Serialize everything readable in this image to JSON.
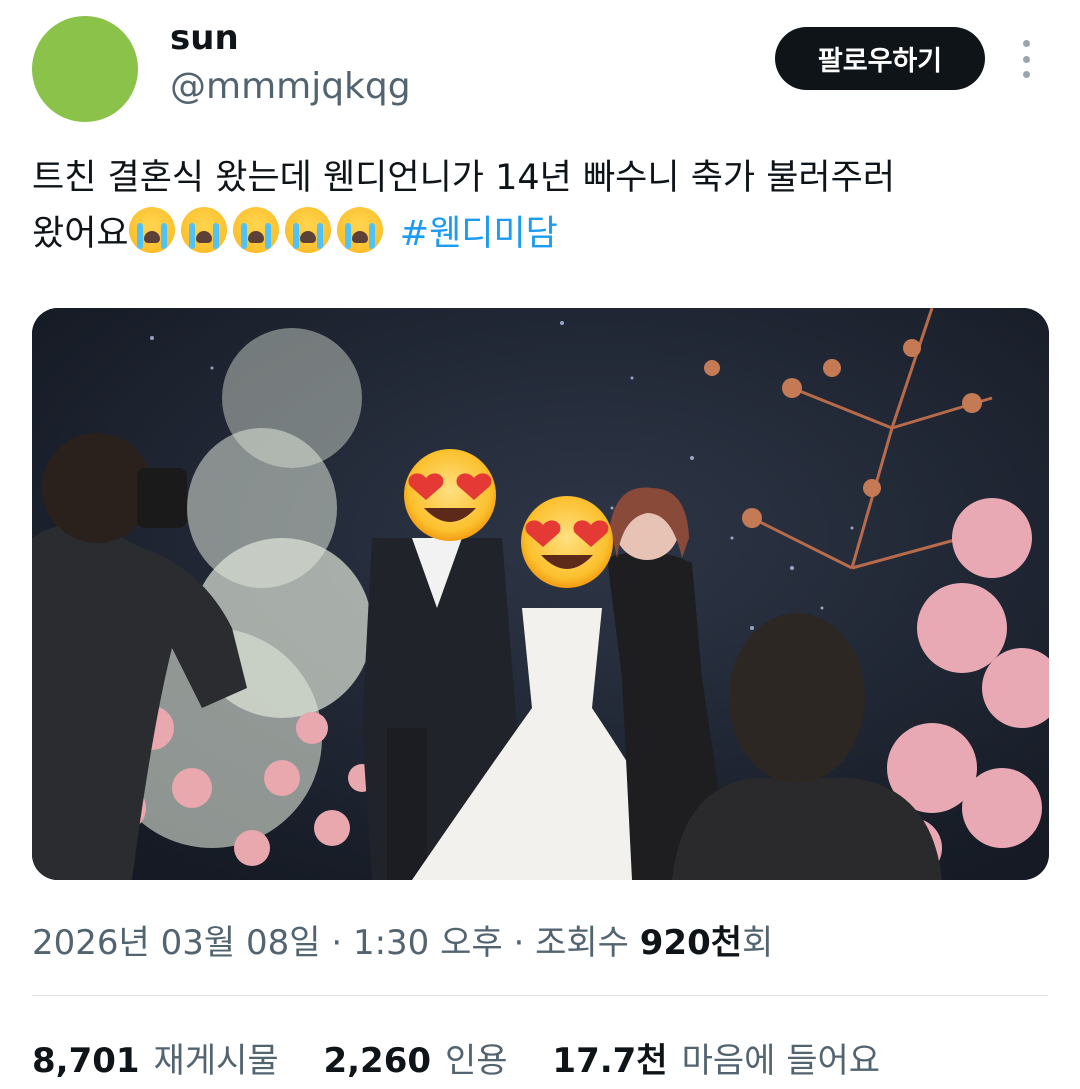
{
  "user": {
    "display_name": "sun",
    "handle": "@mmmjqkqg",
    "avatar_color": "#8bc34a"
  },
  "follow_button_label": "팔로우하기",
  "more_icon": "more-vertical-icon",
  "tweet": {
    "text_line1": "트친 결혼식 왔는데 웬디언니가 14년 빠수니 축가 불러주러",
    "text_line2_prefix": "왔어요",
    "emoji_name": "loudly-crying-face-emoji",
    "emoji_count": 5,
    "hashtag": "#웬디미담"
  },
  "meta": {
    "date": "2026년 03월 08일",
    "separator": " · ",
    "time": "1:30 오후",
    "views_label": "조회수 ",
    "views_value": "920천",
    "views_suffix": "회"
  },
  "stats": {
    "reposts_value": "8,701",
    "reposts_label": "재게시물",
    "quotes_value": "2,260",
    "quotes_label": "인용",
    "likes_value": "17.7천",
    "likes_label": "마음에 들어요"
  },
  "colors": {
    "text_primary": "#0f1419",
    "text_secondary": "#536471",
    "hashtag": "#1d9bf0",
    "button_bg": "#0f1419"
  }
}
